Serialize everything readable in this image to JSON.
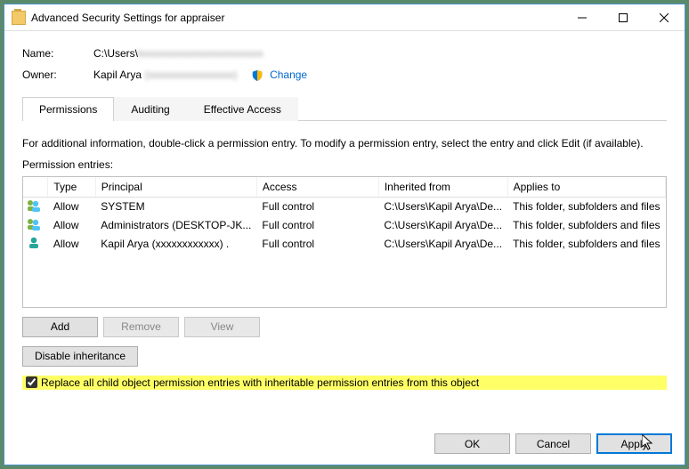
{
  "titlebar": {
    "title": "Advanced Security Settings for appraiser"
  },
  "fields": {
    "name_label": "Name:",
    "name_value": "C:\\Users\\",
    "name_blur": "lxxxxxxxxxxxxxxxxxxxxxxx",
    "owner_label": "Owner:",
    "owner_value": "Kapil Arya ",
    "owner_blur": "(xxxxxxxxxxxxxxxx)",
    "change": "Change"
  },
  "tabs": {
    "permissions": "Permissions",
    "auditing": "Auditing",
    "effective": "Effective Access"
  },
  "info": "For additional information, double-click a permission entry. To modify a permission entry, select the entry and click Edit (if available).",
  "entries_label": "Permission entries:",
  "columns": {
    "type": "Type",
    "principal": "Principal",
    "access": "Access",
    "inherited": "Inherited from",
    "applies": "Applies to"
  },
  "rows": [
    {
      "type": "Allow",
      "principal": "SYSTEM",
      "access": "Full control",
      "inherited": "C:\\Users\\Kapil Arya\\De...",
      "applies": "This folder, subfolders and files"
    },
    {
      "type": "Allow",
      "principal": "Administrators (DESKTOP-JK...",
      "access": "Full control",
      "inherited": "C:\\Users\\Kapil Arya\\De...",
      "applies": "This folder, subfolders and files"
    },
    {
      "type": "Allow",
      "principal": "Kapil Arya (xxxxxxxxxxxx) .",
      "access": "Full control",
      "inherited": "C:\\Users\\Kapil Arya\\De...",
      "applies": "This folder, subfolders and files"
    }
  ],
  "buttons": {
    "add": "Add",
    "remove": "Remove",
    "view": "View",
    "disable": "Disable inheritance",
    "ok": "OK",
    "cancel": "Cancel",
    "apply": "Apply"
  },
  "checkbox": "Replace all child object permission entries with inheritable permission entries from this object"
}
